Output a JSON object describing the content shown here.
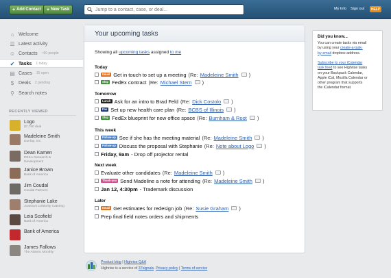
{
  "topbar": {
    "add_contact": "Add Contact",
    "new_task": "New Task",
    "search_placeholder": "Jump to a contact, case, or deal...",
    "my_info": "My Info",
    "sign_out": "Sign out",
    "help": "HELP"
  },
  "nav": [
    {
      "label": "Welcome",
      "count": "",
      "icon": "home-icon"
    },
    {
      "label": "Latest activity",
      "count": "",
      "icon": "activity-icon"
    },
    {
      "label": "Contacts",
      "count": "~60 people",
      "icon": "contacts-icon"
    },
    {
      "label": "Tasks",
      "count": "1 today",
      "icon": "check-icon",
      "selected": true
    },
    {
      "label": "Cases",
      "count": "15 open",
      "icon": "folder-icon"
    },
    {
      "label": "Deals",
      "count": "2 pending",
      "icon": "deals-icon"
    },
    {
      "label": "Search notes",
      "count": "",
      "icon": "search-icon"
    }
  ],
  "recent": {
    "heading": "RECENTLY VIEWED",
    "items": [
      {
        "name": "Logo",
        "sub": "$7,750 deal",
        "color": "#d8b12a"
      },
      {
        "name": "Madeleine Smith",
        "sub": "Dunlop, Inc.",
        "color": "#9a7a64"
      },
      {
        "name": "Dean Kamen",
        "sub": "DEKA Research &\nDevelopment",
        "color": "#7a6c63"
      },
      {
        "name": "Janice Brown",
        "sub": "Bank of America",
        "color": "#8c6b57"
      },
      {
        "name": "Jim Coudal",
        "sub": "Coudal Partners",
        "color": "#6e6a66"
      },
      {
        "name": "Stephanie Lake",
        "sub": "Joanna's Celebrity Catering",
        "color": "#a07e6e"
      },
      {
        "name": "Leia Scofield",
        "sub": "Bank of America",
        "color": "#5c4a42"
      },
      {
        "name": "Bank of America",
        "sub": "",
        "color": "#c3282c"
      },
      {
        "name": "James Fallows",
        "sub": "The Atlantic Monthly",
        "color": "#8c8680"
      }
    ]
  },
  "main": {
    "title": "Your upcoming tasks",
    "showing_prefix": "Showing all",
    "showing_link1": "upcoming tasks",
    "showing_mid": "assigned",
    "showing_link2": "to me",
    "sections": [
      {
        "label": "Today",
        "tasks": [
          {
            "tag": "Email",
            "tag_color": "#e0701e",
            "text": "Get in touch to set up a meeting",
            "re_prefix": "(Re:",
            "re": "Madeleine Smith",
            "re_suffix": ")"
          },
          {
            "tag": "Ship",
            "tag_color": "#3f8e3a",
            "text": "FedEx contract",
            "re_prefix": "(Re:",
            "re": "Michael Stern",
            "re_suffix": ")"
          }
        ]
      },
      {
        "label": "Tomorrow",
        "tasks": [
          {
            "tag": "Lunch",
            "tag_color": "#222222",
            "text": "Ask for an intro to Brad Feld",
            "re_prefix": "(Re:",
            "re": "Dick Costolo",
            "re_suffix": ")"
          },
          {
            "tag": "Fax",
            "tag_color": "#1d3e7a",
            "text": "Set up new health care plan",
            "re_prefix": "(Re:",
            "re": "BCBS of Illinois",
            "re_suffix": ")"
          },
          {
            "tag": "Ship",
            "tag_color": "#3f8e3a",
            "text": "FedEx blueprint for new office space",
            "re_prefix": "(Re:",
            "re": "Burnham & Root",
            "re_suffix": ")"
          }
        ]
      },
      {
        "label": "This week",
        "tasks": [
          {
            "tag": "Follow-up",
            "tag_color": "#4a7fc0",
            "text": "See if she has the meeting material",
            "re_prefix": "(Re:",
            "re": "Madeleine Smith",
            "re_suffix": ")"
          },
          {
            "tag": "Follow-up",
            "tag_color": "#4a7fc0",
            "text": "Discuss the proposal with Stephanie",
            "re_prefix": "(Re:",
            "re": "Note about Logo",
            "re_suffix": ")"
          },
          {
            "tag": "",
            "tag_color": "",
            "bold": "Friday, 9am",
            "text": "- Drop off projector rental",
            "re_prefix": "",
            "re": "",
            "re_suffix": ""
          }
        ]
      },
      {
        "label": "Next week",
        "tasks": [
          {
            "tag": "",
            "tag_color": "",
            "text": "Evaluate other candidates",
            "re_prefix": "(Re:",
            "re": "Madeleine Smith",
            "re_suffix": ")"
          },
          {
            "tag": "Thank-you",
            "tag_color": "#d0508e",
            "text": "Send Madeline a note for attending",
            "re_prefix": "(Re:",
            "re": "Madeleine Smith",
            "re_suffix": ")"
          },
          {
            "tag": "",
            "tag_color": "",
            "bold": "Jan 12, 4:30pm",
            "text": "- Trademark discussion",
            "re_prefix": "",
            "re": "",
            "re_suffix": ""
          }
        ]
      },
      {
        "label": "Later",
        "tasks": [
          {
            "tag": "Email",
            "tag_color": "#e0701e",
            "text": "Get estimates for redesign job",
            "re_prefix": "(Re:",
            "re": "Susie Graham",
            "re_suffix": ")"
          },
          {
            "tag": "",
            "tag_color": "",
            "text": "Prep final field notes orders and shipments",
            "re_prefix": "",
            "re": "",
            "re_suffix": ""
          }
        ]
      }
    ]
  },
  "did_you_know": {
    "title": "Did you know...",
    "p1_a": "You can create tasks via email\nby using your ",
    "p1_link": "create-a-task-\nby-email",
    "p1_b": " dropbox address.",
    "p2_link": "Subscribe to your iCalendar\ntask feed",
    "p2_b": " to see Highrise tasks\non your Backpack Calendar,\nApple iCal, Mozilla Calendar or\nother program that supports\nthe iCalendar format."
  },
  "footer": {
    "product_blog": "Product blog",
    "sep": "|",
    "highrise_qa": "Highrise Q&A",
    "service_prefix": "Highrise is a service of",
    "company": "37signals",
    "privacy": "Privacy policy",
    "terms": "Terms of service"
  }
}
